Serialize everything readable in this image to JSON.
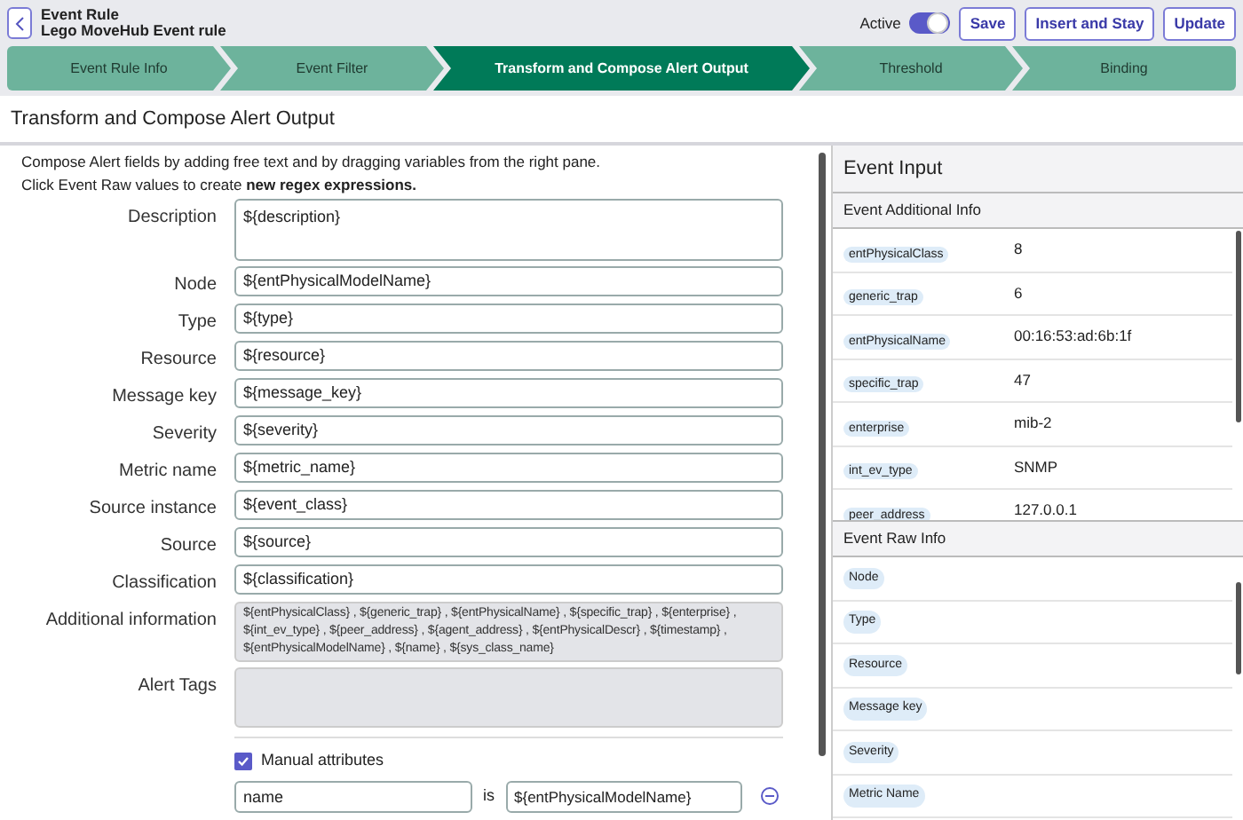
{
  "header": {
    "title": "Event Rule",
    "subtitle": "Lego MoveHub Event rule",
    "active_label": "Active",
    "active": true,
    "buttons": [
      "Save",
      "Insert and Stay",
      "Update"
    ]
  },
  "steps": [
    {
      "label": "Event Rule Info",
      "selected": false
    },
    {
      "label": "Event Filter",
      "selected": false
    },
    {
      "label": "Transform and Compose Alert Output",
      "selected": true
    },
    {
      "label": "Threshold",
      "selected": false
    },
    {
      "label": "Binding",
      "selected": false
    }
  ],
  "section_title": "Transform and Compose Alert Output",
  "intro": [
    "Compose Alert fields by adding free text and by dragging variables from the right pane.",
    "Click Event Raw values to create **new regex expressions.**"
  ],
  "fields": [
    {
      "label": "Description",
      "value": "${description}",
      "kind": "textarea"
    },
    {
      "label": "Node",
      "value": "${entPhysicalModelName}",
      "kind": "input"
    },
    {
      "label": "Type",
      "value": "${type}",
      "kind": "input"
    },
    {
      "label": "Resource",
      "value": "${resource}",
      "kind": "input"
    },
    {
      "label": "Message key",
      "value": "${message_key}",
      "kind": "input"
    },
    {
      "label": "Severity",
      "value": "${severity}",
      "kind": "input"
    },
    {
      "label": "Metric name",
      "value": "${metric_name}",
      "kind": "input"
    },
    {
      "label": "Source instance",
      "value": "${event_class}",
      "kind": "input"
    },
    {
      "label": "Source",
      "value": "${source}",
      "kind": "input"
    },
    {
      "label": "Classification",
      "value": "${classification}",
      "kind": "input"
    },
    {
      "label": "Additional information",
      "value": "${entPhysicalClass} , ${generic_trap} , ${entPhysicalName} , ${specific_trap} , ${enterprise} , ${int_ev_type} , ${peer_address} , ${agent_address} , ${entPhysicalDescr} , ${timestamp} , ${entPhysicalModelName} , ${name} , ${sys_class_name}",
      "kind": "readonly"
    },
    {
      "label": "Alert Tags",
      "kind": "readonly"
    }
  ],
  "manual_attributes": {
    "label": "Manual attributes",
    "checked": true,
    "rows": [
      {
        "name": "name",
        "operator": "is",
        "value": "${entPhysicalModelName}"
      }
    ]
  },
  "event_input": {
    "title": "Event Input",
    "additional_info": {
      "title": "Event Additional Info",
      "rows": [
        {
          "key": "entPhysicalClass",
          "value": "8"
        },
        {
          "key": "generic_trap",
          "value": "6"
        },
        {
          "key": "entPhysicalName",
          "value": "00:16:53:ad:6b:1f"
        },
        {
          "key": "specific_trap",
          "value": "47"
        },
        {
          "key": "enterprise",
          "value": "mib-2"
        },
        {
          "key": "int_ev_type",
          "value": "SNMP"
        },
        {
          "key": "peer_address",
          "value": "127.0.0.1"
        }
      ]
    },
    "raw_info": {
      "title": "Event Raw Info",
      "rows": [
        "Node",
        "Type",
        "Resource",
        "Message key",
        "Severity",
        "Metric Name"
      ]
    }
  }
}
